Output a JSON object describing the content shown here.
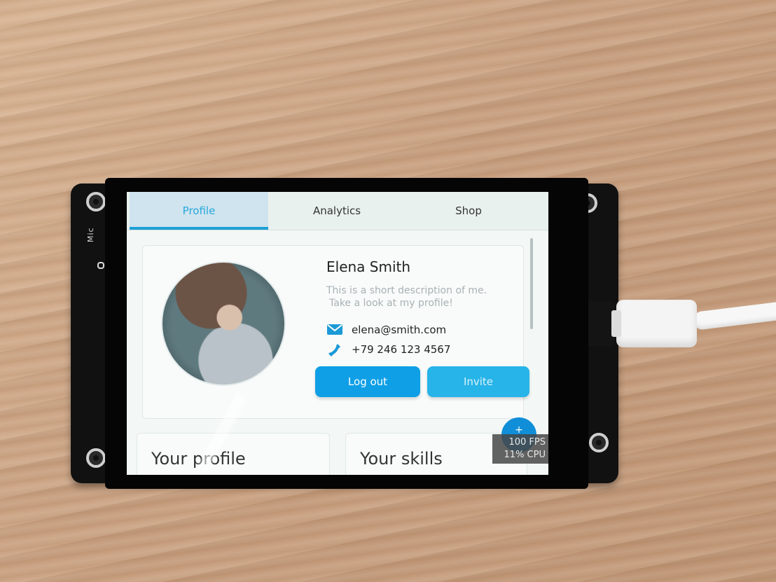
{
  "device": {
    "board_label": "Mic"
  },
  "tabs": [
    {
      "label": "Profile",
      "active": true
    },
    {
      "label": "Analytics",
      "active": false
    },
    {
      "label": "Shop",
      "active": false
    }
  ],
  "profile": {
    "name": "Elena Smith",
    "description_line1": "This is a short description of me.",
    "description_line2": "Take a look at my profile!",
    "email": "elena@smith.com",
    "phone": "+79 246 123 4567",
    "logout_label": "Log out",
    "invite_label": "Invite"
  },
  "cards": {
    "your_profile": "Your profile",
    "your_skills": "Your skills"
  },
  "perf": {
    "fps": "100 FPS",
    "cpu": "11% CPU"
  },
  "colors": {
    "accent": "#1e9fd6",
    "logout_button": "#0f9fe6",
    "invite_button": "#27b4e8"
  },
  "icons": {
    "email": "envelope-icon",
    "phone": "phone-icon"
  }
}
